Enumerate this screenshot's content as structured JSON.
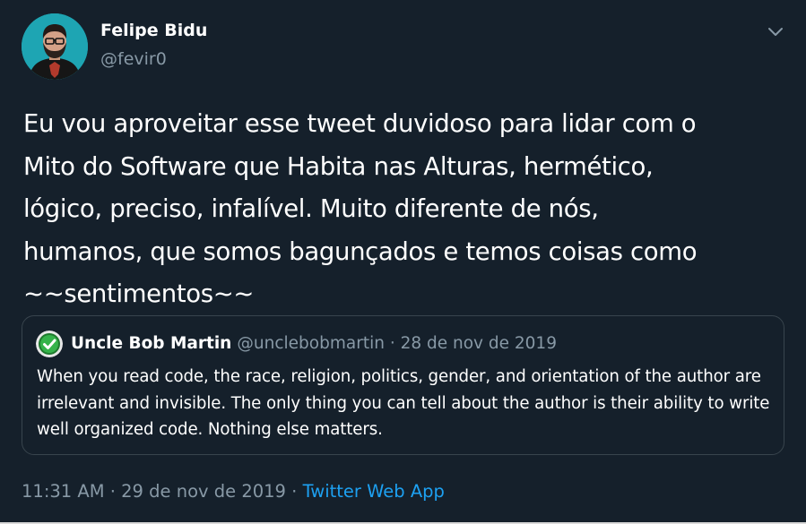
{
  "tweet": {
    "author": {
      "name": "Felipe Bidu",
      "handle": "@fevir0"
    },
    "text": "Eu vou aproveitar esse tweet duvidoso para lidar com o\nMito do Software que Habita nas Alturas, hermético,\nlógico, preciso, infalível. Muito diferente de nós,\nhumanos, que somos bagunçados e temos coisas como\n~~sentimentos~~",
    "quoted": {
      "name": "Uncle Bob Martin",
      "meta": "@unclebobmartin · 28 de nov de 2019",
      "text": "When you read code, the race, religion, politics, gender, and orientation of the author are irrelevant and invisible. The only thing you can tell about the author is their ability to write well organized code. Nothing else matters."
    },
    "timestamp": "11:31 AM · 29 de nov de 2019 · ",
    "source_app": "Twitter Web App"
  },
  "colors": {
    "background": "#15202b",
    "text": "#ffffff",
    "secondary": "#8899a6",
    "accent": "#1da1f2",
    "border": "#38444d"
  },
  "icons": {
    "caret": "chevron-down-icon",
    "quote_avatar": "verified-check-avatar"
  }
}
